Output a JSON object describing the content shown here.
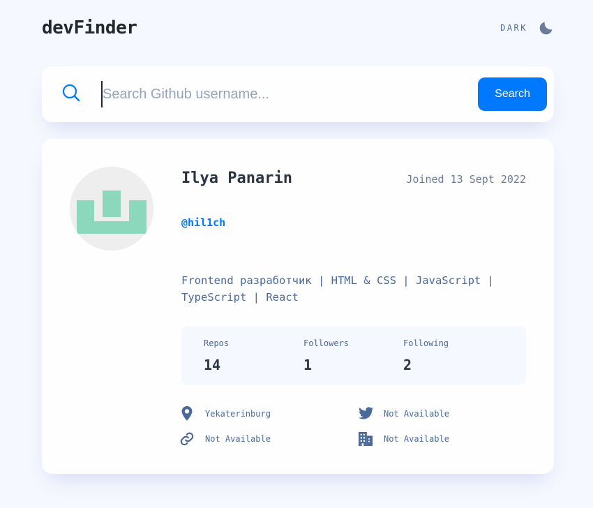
{
  "header": {
    "logo": "devFinder",
    "theme_label": "DARK",
    "theme_icon": "moon-icon"
  },
  "search": {
    "icon": "search-icon",
    "placeholder": "Search Github username...",
    "value": "",
    "button_label": "Search"
  },
  "profile": {
    "name": "Ilya Panarin",
    "joined": "Joined 13 Sept 2022",
    "login": "@hil1ch",
    "bio": "Frontend разработчик | HTML & CSS | JavaScript | TypeScript | React",
    "stats": [
      {
        "label": "Repos",
        "value": "14"
      },
      {
        "label": "Followers",
        "value": "1"
      },
      {
        "label": "Following",
        "value": "2"
      }
    ],
    "links": {
      "location": {
        "icon": "location-pin-icon",
        "text": "Yekaterinburg"
      },
      "blog": {
        "icon": "link-icon",
        "text": "Not Available"
      },
      "twitter": {
        "icon": "twitter-icon",
        "text": "Not Available"
      },
      "company": {
        "icon": "company-building-icon",
        "text": "Not Available"
      }
    }
  },
  "colors": {
    "accent": "#0079ff",
    "background": "#f6f8ff",
    "card": "#fefefe",
    "avatar_identicon": "#8bd8bd"
  }
}
